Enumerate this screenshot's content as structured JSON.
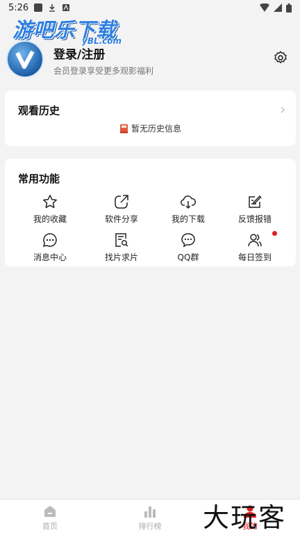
{
  "status_bar": {
    "time": "5:26"
  },
  "watermark_top": {
    "title": "游吧乐下载",
    "sub": "yBL.com"
  },
  "profile": {
    "title": "登录/注册",
    "subtitle": "会员登录享受更多观影福利"
  },
  "history": {
    "title": "观看历史",
    "empty_text": "暂无历史信息"
  },
  "functions": {
    "title": "常用功能",
    "items": [
      {
        "label": "我的收藏",
        "icon": "star-icon"
      },
      {
        "label": "软件分享",
        "icon": "share-icon"
      },
      {
        "label": "我的下载",
        "icon": "cloud-download-icon"
      },
      {
        "label": "反馈报错",
        "icon": "edit-icon"
      },
      {
        "label": "消息中心",
        "icon": "message-icon"
      },
      {
        "label": "找片求片",
        "icon": "search-doc-icon"
      },
      {
        "label": "QQ群",
        "icon": "chat-icon"
      },
      {
        "label": "每日签到",
        "icon": "users-icon"
      }
    ]
  },
  "tabbar": {
    "home": "首页",
    "ranking": "排行榜",
    "mine": "我的"
  },
  "watermark_bottom": "大玩客",
  "colors": {
    "accent": "#e02020",
    "brand_blue": "#2f7fe0"
  }
}
